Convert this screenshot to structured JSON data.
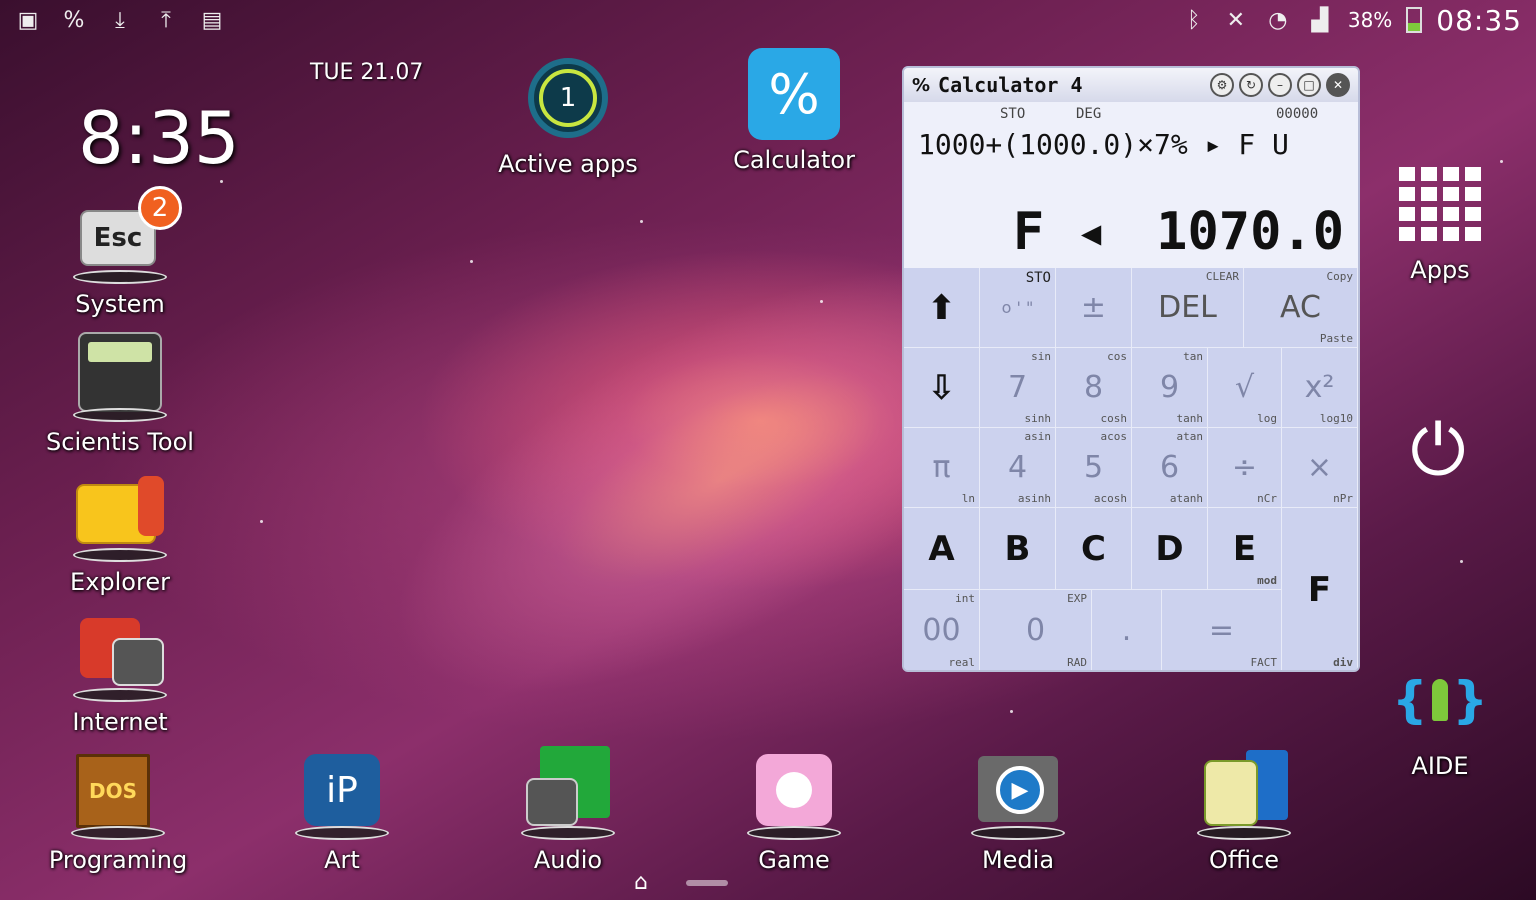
{
  "statusbar": {
    "left_icons": [
      "image-icon",
      "percent-icon",
      "download-icon",
      "upload-icon",
      "file-icon"
    ],
    "battery_pct": "38%",
    "battery_level": 0.38,
    "clock": "08:35"
  },
  "widget": {
    "date": "TUE  21.07",
    "time": "8:35"
  },
  "apps": {
    "system": {
      "label": "System",
      "badge": "2",
      "key_text": "Esc"
    },
    "scientis": {
      "label": "Scientis Tool"
    },
    "explorer": {
      "label": "Explorer"
    },
    "internet": {
      "label": "Internet"
    },
    "programing": {
      "label": "Programing",
      "box_text": "DOS"
    },
    "active": {
      "label": "Active apps",
      "count": "1"
    },
    "calculator": {
      "label": "Calculator"
    },
    "apps_drawer": {
      "label": "Apps"
    },
    "aide": {
      "label": "AIDE"
    },
    "art": {
      "label": "Art"
    },
    "audio": {
      "label": "Audio"
    },
    "game": {
      "label": "Game"
    },
    "media": {
      "label": "Media"
    },
    "office": {
      "label": "Office"
    }
  },
  "calc": {
    "title": "Calculator 4",
    "indicators": {
      "sto": "STO",
      "deg": "DEG",
      "mem": "00000"
    },
    "expression": "1000+(1000.0)×7% ▸ F U",
    "result_prefix": "F ◂",
    "result": "1070.0",
    "keys": {
      "up": "⬆",
      "down": "⇩",
      "sto_label": "STO",
      "dms": "o ' \"",
      "pm": "±",
      "del": "DEL",
      "ac": "AC",
      "clear": "CLEAR",
      "copy": "Copy",
      "paste": "Paste",
      "k7": "7",
      "k8": "8",
      "k9": "9",
      "sqrt": "√",
      "x2": "x²",
      "sin": "sin",
      "cos": "cos",
      "tan": "tan",
      "sinh": "sinh",
      "cosh": "cosh",
      "tanh": "tanh",
      "log": "log",
      "log10": "log10",
      "pi": "π",
      "k4": "4",
      "k5": "5",
      "k6": "6",
      "div": "÷",
      "mul": "×",
      "asin": "asin",
      "acos": "acos",
      "atan": "atan",
      "asinh": "asinh",
      "acosh": "acosh",
      "atanh": "atanh",
      "ln": "ln",
      "ncr": "nCr",
      "npr": "nPr",
      "A": "A",
      "B": "B",
      "C": "C",
      "D": "D",
      "E": "E",
      "F": "F",
      "k00": "00",
      "k0": "0",
      "dot": ".",
      "eq": "=",
      "exp": "EXP",
      "rad": "RAD",
      "fact": "FACT",
      "int": "int",
      "real": "real",
      "div_lbl": "div",
      "mod": "mod"
    }
  },
  "colors": {
    "calc_bg": "#dfe3f5",
    "key_bg": "#ccd2ee",
    "badge": "#f06020",
    "calc_app_tile": "#2aa8e6",
    "aide": "#7ec83b"
  }
}
